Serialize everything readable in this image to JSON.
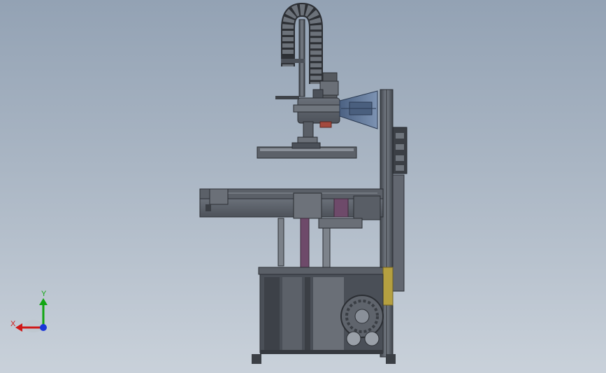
{
  "viewport": {
    "background_top": "#93a2b4",
    "background_bottom": "#c9d1da"
  },
  "model": {
    "frame_color": "#4a4f57",
    "panel_color": "#5e636b",
    "accent_blue": "#5a7394",
    "accent_yellow": "#b5a040",
    "accent_purple": "#6e4a6a",
    "accent_red": "#a44a3e"
  },
  "triad": {
    "x_label": "X",
    "y_label": "Y",
    "x_color": "#d01818",
    "y_color": "#12a612",
    "z_color": "#1a36d8"
  }
}
